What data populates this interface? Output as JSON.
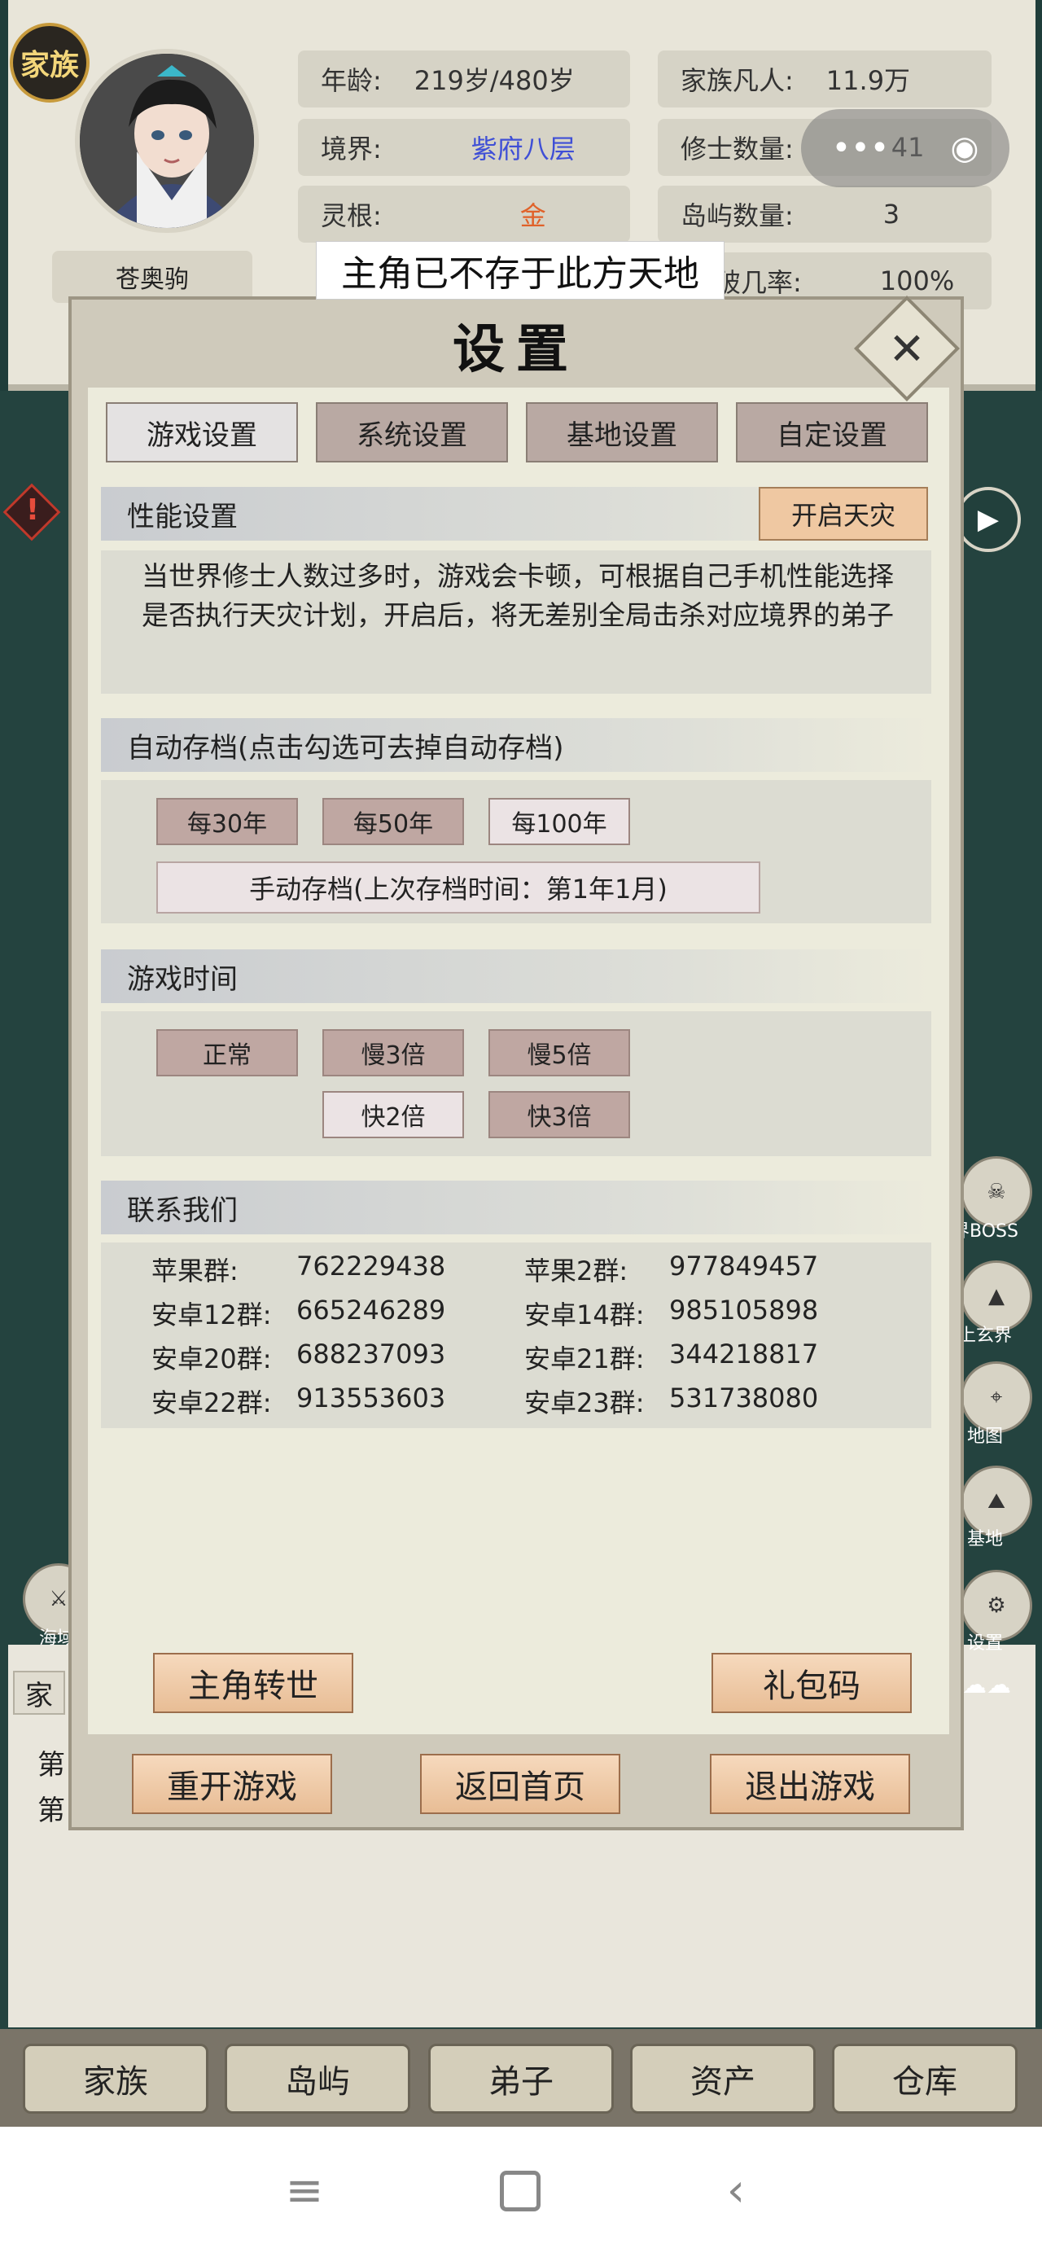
{
  "header": {
    "family_badge": "家族",
    "player_name": "苍奥驹",
    "left_stats": [
      {
        "label": "年龄:",
        "value": "219岁/480岁",
        "color": "#333333"
      },
      {
        "label": "境界:",
        "value": "紫府八层",
        "color": "#3f4fd6"
      },
      {
        "label": "灵根:",
        "value": "金",
        "color": "#e0622a"
      }
    ],
    "right_stats": [
      {
        "label": "家族凡人:",
        "value": "11.9万"
      },
      {
        "label": "修士数量:",
        "value": "41"
      },
      {
        "label": "岛屿数量:",
        "value": "3"
      },
      {
        "label": "破几率:",
        "value": "100%"
      }
    ]
  },
  "tooltip": "主角已不存于此方天地",
  "modal": {
    "title": "设置",
    "tabs": [
      "游戏设置",
      "系统设置",
      "基地设置",
      "自定设置"
    ],
    "performance": {
      "heading": "性能设置",
      "button": "开启天灾",
      "description": "当世界修士人数过多时，游戏会卡顿，可根据自己手机性能选择是否执行天灾计划，开启后，将无差别全局击杀对应境界的弟子"
    },
    "autosave": {
      "heading": "自动存档(点击勾选可去掉自动存档)",
      "options": [
        "每30年",
        "每50年",
        "每100年"
      ],
      "manual": "手动存档(上次存档时间：第1年1月)"
    },
    "game_time": {
      "heading": "游戏时间",
      "row1": [
        "正常",
        "慢3倍",
        "慢5倍"
      ],
      "row2": [
        "快2倍",
        "快3倍"
      ]
    },
    "contact": {
      "heading": "联系我们",
      "groups": [
        {
          "label": "苹果群:",
          "number": "762229438"
        },
        {
          "label": "苹果2群:",
          "number": "977849457"
        },
        {
          "label": "安卓12群:",
          "number": "665246289"
        },
        {
          "label": "安卓14群:",
          "number": "985105898"
        },
        {
          "label": "安卓20群:",
          "number": "688237093"
        },
        {
          "label": "安卓21群:",
          "number": "344218817"
        },
        {
          "label": "安卓22群:",
          "number": "913553603"
        },
        {
          "label": "安卓23群:",
          "number": "531738080"
        }
      ]
    },
    "buttons": {
      "reincarnate": "主角转世",
      "gift_code": "礼包码",
      "restart": "重开游戏",
      "home": "返回首页",
      "exit": "退出游戏"
    }
  },
  "side_icons": [
    {
      "label": "界BOSS",
      "icon": "demon-icon"
    },
    {
      "label": "上玄界",
      "icon": "mountain-icon"
    },
    {
      "label": "地图",
      "icon": "map-pin-icon"
    },
    {
      "label": "基地",
      "icon": "peak-icon"
    },
    {
      "label": "设置",
      "icon": "gear-icon"
    }
  ],
  "left_icon_label": "海域",
  "background_fragments": {
    "family_tab": "家",
    "line1": "第",
    "line2": "第"
  },
  "bottom_nav": [
    "家族",
    "岛屿",
    "弟子",
    "资产",
    "仓库"
  ]
}
